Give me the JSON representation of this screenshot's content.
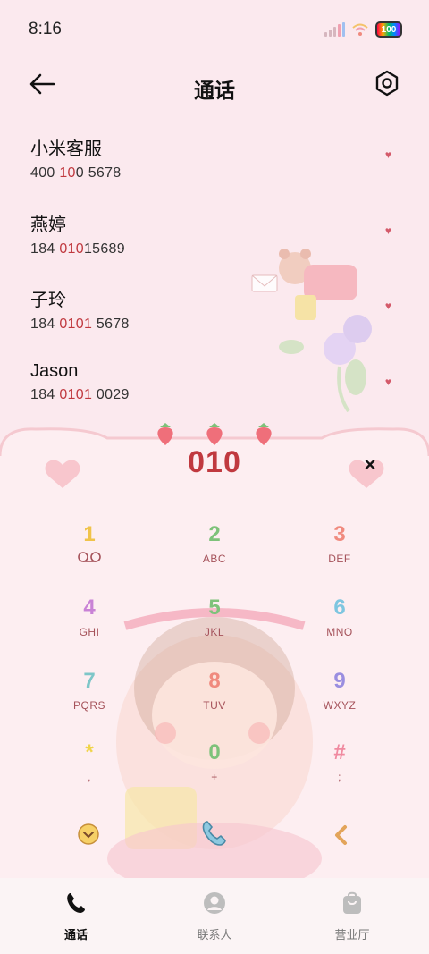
{
  "status_bar": {
    "time": "8:16",
    "battery": "100"
  },
  "header": {
    "title": "通话"
  },
  "contacts": [
    {
      "name": "小米客服",
      "num_a": "400 ",
      "num_b": "10",
      "num_c": "0 5678"
    },
    {
      "name": "燕婷",
      "num_a": "184 ",
      "num_b": "010",
      "num_c": "15689"
    },
    {
      "name": "子玲",
      "num_a": "184 ",
      "num_b": "0101",
      "num_c": " 5678"
    },
    {
      "name": "Jason",
      "num_a": "184 ",
      "num_b": "0101",
      "num_c": " 0029"
    }
  ],
  "dialer": {
    "entered_digits": "010",
    "keys": [
      {
        "digit": "1",
        "letters": "",
        "color": "#f0c34a"
      },
      {
        "digit": "2",
        "letters": "ABC",
        "color": "#7ec27a"
      },
      {
        "digit": "3",
        "letters": "DEF",
        "color": "#f08a7e"
      },
      {
        "digit": "4",
        "letters": "GHI",
        "color": "#c982d6"
      },
      {
        "digit": "5",
        "letters": "JKL",
        "color": "#7ec27a"
      },
      {
        "digit": "6",
        "letters": "MNO",
        "color": "#7ec6e0"
      },
      {
        "digit": "7",
        "letters": "PQRS",
        "color": "#7ec6c8"
      },
      {
        "digit": "8",
        "letters": "TUV",
        "color": "#f08a7e"
      },
      {
        "digit": "9",
        "letters": "WXYZ",
        "color": "#9a8ee0"
      },
      {
        "digit": "*",
        "letters": ",",
        "color": "#f0d44a"
      },
      {
        "digit": "0",
        "letters": "+",
        "color": "#7ec27a"
      },
      {
        "digit": "#",
        "letters": ";",
        "color": "#f08aa0"
      }
    ]
  },
  "bottom_nav": [
    {
      "label": "通话",
      "icon": "phone-icon",
      "active": true
    },
    {
      "label": "联系人",
      "icon": "person-icon",
      "active": false
    },
    {
      "label": "营业厅",
      "icon": "shopping-bag-icon",
      "active": false
    }
  ],
  "colors": {
    "accent": "#c0393f",
    "background": "#fbe9ee",
    "key_letters": "#a5525a"
  }
}
